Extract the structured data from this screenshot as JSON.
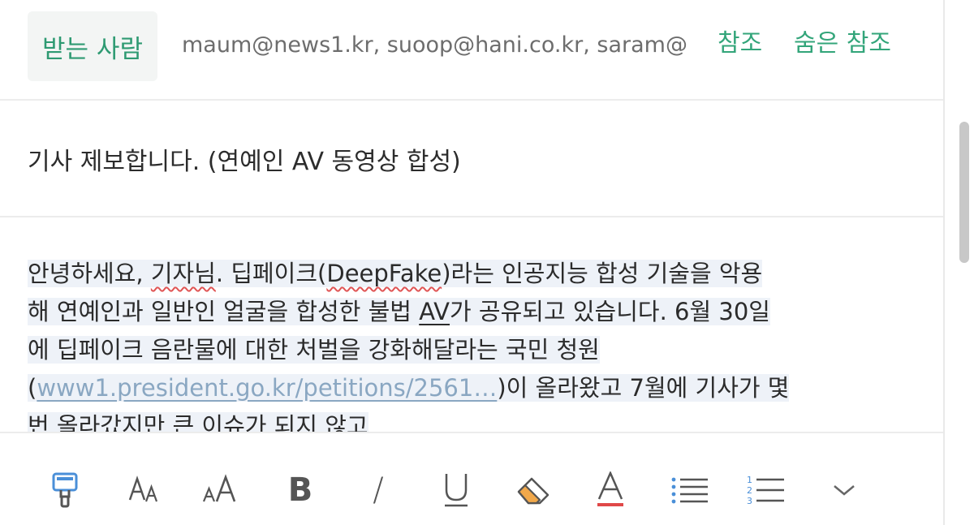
{
  "header": {
    "to_label": "받는 사람",
    "to_addresses": "maum@news1.kr, suoop@hani.co.kr, saram@",
    "cc_label": "참조",
    "bcc_label": "숨은 참조"
  },
  "subject": "기사 제보합니다. (연예인 AV 동영상 합성)",
  "body": {
    "l1_a": "안녕하세요, ",
    "l1_b": "기자님",
    "l1_c": ". 딥페이크(",
    "l1_d": "DeepFake",
    "l1_e": ")라는 인공지능 합성 기술을 악용",
    "l2_a": "해 연예인과 일반인 얼굴을 합성한 불법 ",
    "l2_b": "AV",
    "l2_c": "가 공유되고 있습니다. 6월 30일",
    "l3": "에 딥페이크 음란물에 대한 처벌을 강화해달라는 국민 청원",
    "l4_a": "(",
    "l4_link": "www1.president.go.kr/petitions/2561…",
    "l4_b": ")이 올라왔고 7월에 기사가 몇",
    "l5": "번 올라갔지만 큰 이슈가 되지 않고"
  },
  "toolbar": {
    "bold_label": "B",
    "italic_label": "/",
    "underline_label": "U",
    "font_color_label": "A",
    "font_color": "#e04848",
    "icons": [
      "paint-brush-icon",
      "font-size-decrease-icon",
      "font-size-increase-icon",
      "bold-icon",
      "italic-icon",
      "underline-icon",
      "eraser-icon",
      "font-color-icon",
      "bullet-list-icon",
      "numbered-list-icon",
      "chevron-down-icon"
    ]
  },
  "colors": {
    "accent": "#33a57a",
    "link": "#8aa7c2",
    "highlight": "#eef2f8"
  }
}
